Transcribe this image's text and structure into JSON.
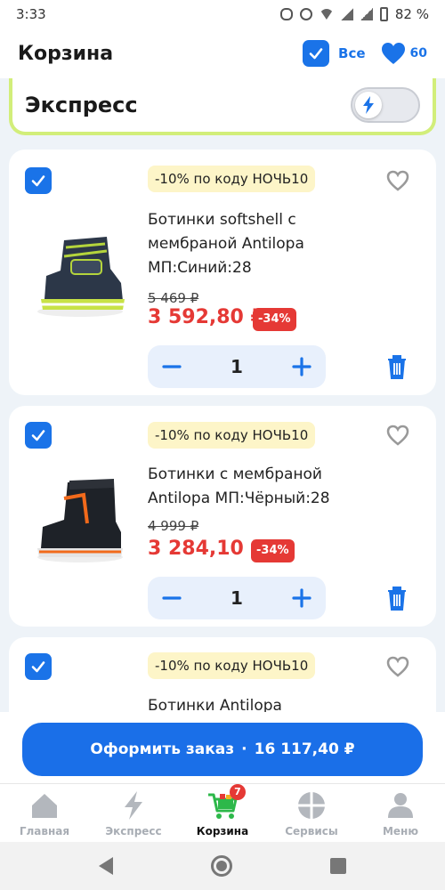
{
  "status_bar": {
    "time": "3:33",
    "battery": "82 %"
  },
  "header": {
    "title": "Корзина",
    "select_all_label": "Все",
    "favorites_count": "60"
  },
  "express": {
    "label": "Экспресс"
  },
  "products": [
    {
      "promo": "-10% по коду НОЧЬ10",
      "name": "Ботинки softshell с мембраной Antilopa МП:Синий:28",
      "old_price": "5 469 ₽",
      "price": "3 592,80 ₽",
      "discount": "-34%",
      "quantity": "1"
    },
    {
      "promo": "-10% по коду НОЧЬ10",
      "name": "Ботинки с мембраной Antilopa МП:Чёрный:28",
      "old_price": "4 999 ₽",
      "price": "3 284,10 ₽",
      "discount": "-34%",
      "quantity": "1"
    },
    {
      "promo": "-10% по коду НОЧЬ10",
      "name": "Ботинки Antilopa"
    }
  ],
  "order": {
    "label": "Оформить заказ",
    "separator": "·",
    "total": "16 117,40 ₽"
  },
  "bottom_nav": [
    {
      "label": "Главная",
      "icon": "home-icon"
    },
    {
      "label": "Экспресс",
      "icon": "lightning-icon"
    },
    {
      "label": "Корзина",
      "icon": "cart-icon",
      "badge": "7",
      "active": true
    },
    {
      "label": "Сервисы",
      "icon": "services-icon"
    },
    {
      "label": "Меню",
      "icon": "profile-icon"
    }
  ],
  "colors": {
    "accent": "#1a73e8",
    "price_red": "#e53935",
    "express_border": "#d2ee7a",
    "promo_bg": "#fdf5c8"
  }
}
